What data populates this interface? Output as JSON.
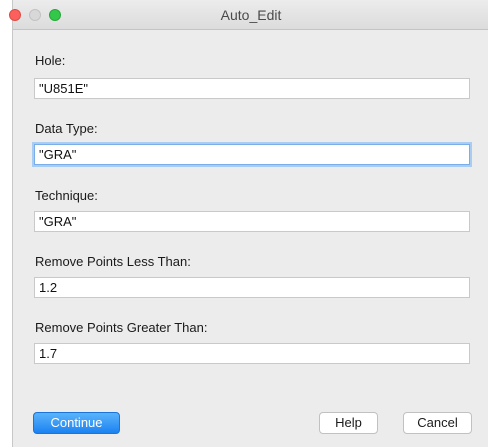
{
  "window": {
    "title": "Auto_Edit"
  },
  "fields": [
    {
      "label": "Hole:",
      "value": "\"U851E\""
    },
    {
      "label": "Data Type:",
      "value": "\"GRA\""
    },
    {
      "label": "Technique:",
      "value": "\"GRA\""
    },
    {
      "label": "Remove Points Less Than:",
      "value": "1.2"
    },
    {
      "label": "Remove Points Greater Than:",
      "value": "1.7"
    }
  ],
  "buttons": {
    "continue": "Continue",
    "help": "Help",
    "cancel": "Cancel"
  },
  "colors": {
    "accent": "#1b82f1",
    "focus_ring": "#a9ccf3"
  }
}
